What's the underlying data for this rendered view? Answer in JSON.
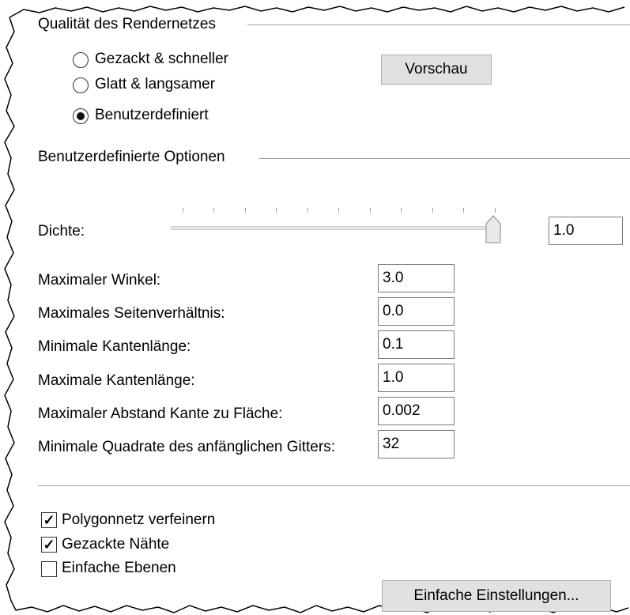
{
  "render_quality": {
    "group_title": "Qualität des Rendernetzes",
    "options": [
      {
        "label": "Gezackt & schneller",
        "selected": false
      },
      {
        "label": "Glatt & langsamer",
        "selected": false
      },
      {
        "label": "Benutzerdefiniert",
        "selected": true
      }
    ],
    "preview_button": "Vorschau"
  },
  "custom_options": {
    "group_title": "Benutzerdefinierte Optionen",
    "density": {
      "label": "Dichte:",
      "value": "1.0",
      "slider_fraction": 1.0
    },
    "fields": [
      {
        "label": "Maximaler Winkel:",
        "value": "3.0"
      },
      {
        "label": "Maximales Seitenverhältnis:",
        "value": "0.0"
      },
      {
        "label": "Minimale Kantenlänge:",
        "value": "0.1"
      },
      {
        "label": "Maximale Kantenlänge:",
        "value": "1.0"
      },
      {
        "label": "Maximaler Abstand Kante zu Fläche:",
        "value": "0.002"
      },
      {
        "label": "Minimale Quadrate des anfänglichen Gitters:",
        "value": "32"
      }
    ]
  },
  "checkboxes": [
    {
      "label": "Polygonnetz verfeinern",
      "checked": true
    },
    {
      "label": "Gezackte Nähte",
      "checked": true
    },
    {
      "label": "Einfache Ebenen",
      "checked": false
    }
  ],
  "simple_settings_button": "Einfache Einstellungen...",
  "colors": {
    "background": "#ffffff",
    "button_face": "#e1e1e1",
    "field_border": "#7a7a7a",
    "torn_edge": "#000000"
  }
}
